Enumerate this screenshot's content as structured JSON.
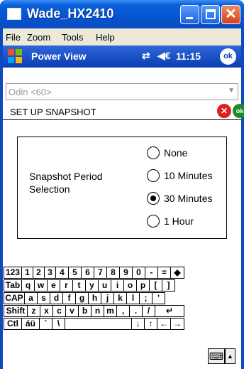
{
  "window": {
    "title": "Wade_HX2410",
    "close_glyph": "✕"
  },
  "menu": {
    "file": "File",
    "zoom": "Zoom",
    "tools": "Tools",
    "help": "Help"
  },
  "nav": {
    "title": "Power View",
    "time": "11:15",
    "ok": "ok",
    "connectivity_glyph": "⇄",
    "speaker_glyph": "◀€"
  },
  "device_selector": {
    "value": "Odin <60>",
    "arrow": "▼"
  },
  "header": {
    "title": "SET UP SNAPSHOT",
    "cancel_glyph": "✕",
    "ok": "ok"
  },
  "snapshot": {
    "label": "Snapshot Period Selection",
    "options": [
      {
        "label": "None",
        "selected": false
      },
      {
        "label": "10 Minutes",
        "selected": false
      },
      {
        "label": "30 Minutes",
        "selected": true
      },
      {
        "label": "1 Hour",
        "selected": false
      }
    ]
  },
  "keyboard": {
    "row1": [
      "123",
      "1",
      "2",
      "3",
      "4",
      "5",
      "6",
      "7",
      "8",
      "9",
      "0",
      "-",
      "=",
      "◆"
    ],
    "row2": [
      "Tab",
      "q",
      "w",
      "e",
      "r",
      "t",
      "y",
      "u",
      "i",
      "o",
      "p",
      "[",
      "]"
    ],
    "row3": [
      "CAP",
      "a",
      "s",
      "d",
      "f",
      "g",
      "h",
      "j",
      "k",
      "l",
      ";",
      "'"
    ],
    "row4": [
      "Shift",
      "z",
      "x",
      "c",
      "v",
      "b",
      "n",
      "m",
      ",",
      ".",
      "/",
      "↵"
    ],
    "row5": [
      "Ctl",
      "áü",
      "`",
      "\\",
      "",
      "↓",
      "↑",
      "←",
      "→"
    ]
  },
  "bottom": {
    "keyboard_icon": "⌨",
    "menu_arrow": "▲"
  }
}
